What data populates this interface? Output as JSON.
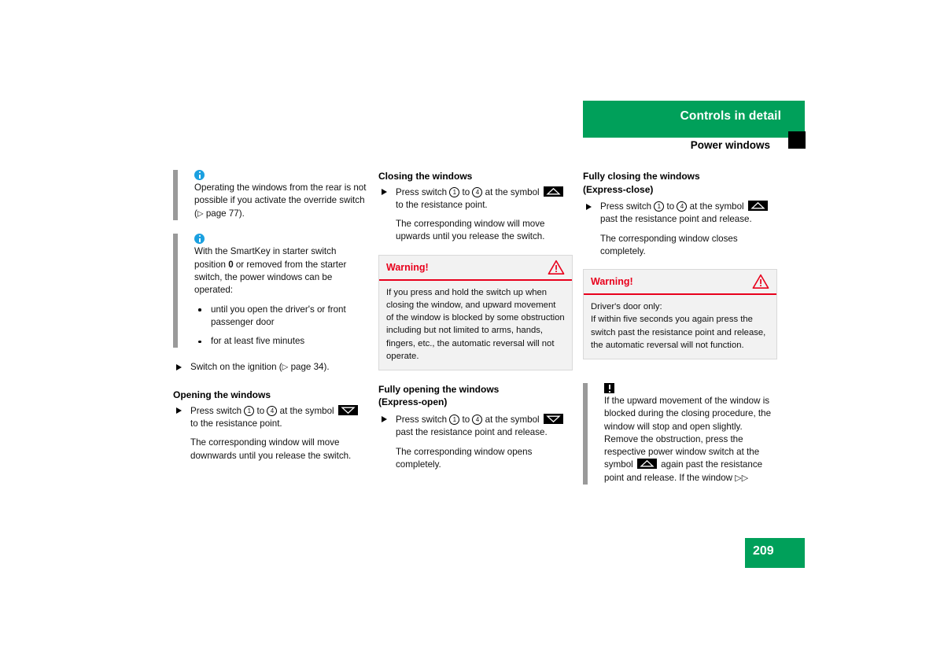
{
  "header": {
    "chapter_title": "Controls in detail",
    "section_title": "Power windows"
  },
  "page": {
    "number": "209"
  },
  "icons": {
    "info": "info-icon",
    "attention": "attention-icon",
    "warning_triangle": "warning-triangle-icon",
    "window_up": "window-up-symbol-icon",
    "window_down": "window-down-symbol-icon",
    "step_arrow": "step-arrow-icon",
    "continue": "continue-arrow-icon"
  },
  "colors": {
    "green": "#00a05a",
    "warning_red": "#e8001c",
    "info_blue": "#1ba0e0",
    "note_rule_gray": "#9a9a9a",
    "warning_bg": "#f2f2f2"
  },
  "left_column": {
    "note_1": "Operating the windows from the rear is not possible if you activate the override switch (",
    "note_1_ref": "page 77).",
    "note_2_intro_a": "With the SmartKey in starter switch position ",
    "note_2_bold": "0",
    "note_2_intro_b": " or removed from the starter switch, the power windows can be operated:",
    "note_2_bullets": [
      "until you open the driver's or front passenger door",
      "for at least five minutes"
    ],
    "step_ignition_a": "Switch on the ignition (",
    "step_ignition_b": "page 34).",
    "heading_opening": "Opening the windows",
    "open_step_a": "Press switch ",
    "open_step_num1": "1",
    "open_step_b": " to ",
    "open_step_num2": "4",
    "open_step_c": " at the symbol ",
    "open_step_d": " to the resistance point.",
    "open_result": "The corresponding window will move downwards until you release the switch."
  },
  "middle_column": {
    "heading_closing": "Closing the windows",
    "close_step_a": "Press switch ",
    "close_step_num1": "1",
    "close_step_b": " to ",
    "close_step_num2": "4",
    "close_step_c": " at the symbol ",
    "close_step_d": " to the resistance point.",
    "close_result": "The corresponding window will move upwards until you release the switch.",
    "warning_title": "Warning!",
    "warning_body": "If you press and hold the switch up when closing the window, and upward movement of the window is blocked by some obstruction including but not limited to arms, hands, fingers, etc., the automatic reversal will not operate.",
    "heading_express_open_line1": "Fully opening the windows",
    "heading_express_open_line2": "(Express-open)",
    "express_open_step_a": "Press switch ",
    "express_open_num1": "1",
    "express_open_step_b": " to ",
    "express_open_num2": "4",
    "express_open_step_c": " at the symbol ",
    "express_open_step_d": " past the resistance point and release.",
    "express_open_result": "The corresponding window opens completely."
  },
  "right_column": {
    "heading_express_close_line1": "Fully closing the windows",
    "heading_express_close_line2": "(Express-close)",
    "express_close_step_a": "Press switch ",
    "express_close_num1": "1",
    "express_close_step_b": " to ",
    "express_close_num2": "4",
    "express_close_step_c": " at the symbol ",
    "express_close_step_d": " past the resistance point and release.",
    "express_close_result": "The corresponding window closes completely.",
    "warning_title": "Warning!",
    "warning_body_line1": "Driver's door only:",
    "warning_body_line2": "If within five seconds you again press the switch past the resistance point and release, the automatic reversal will not function.",
    "note_text_a": "If the upward movement of the window is blocked during the closing procedure, the window will stop and open slightly. Remove the obstruction, press the respective power window switch at the symbol ",
    "note_text_b": " again past the resistance point and release. If the window "
  }
}
